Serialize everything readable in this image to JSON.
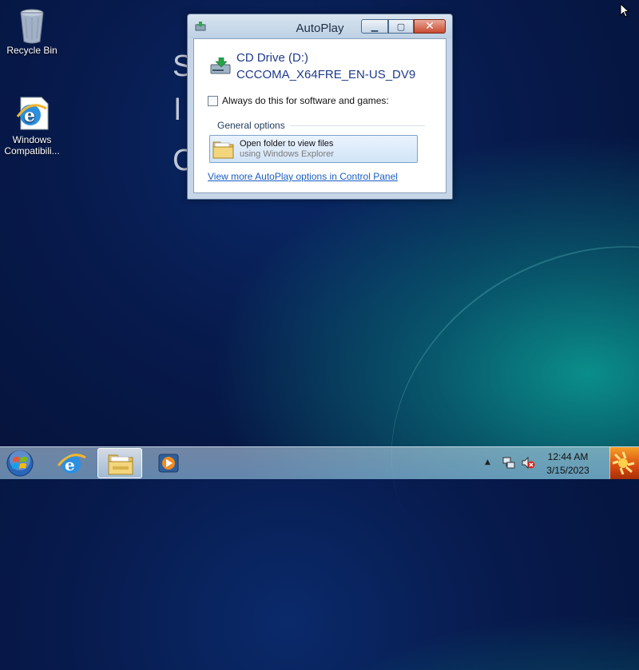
{
  "desktop": {
    "background_letters": [
      "S",
      "l",
      "C"
    ],
    "icons": [
      {
        "label": "Recycle Bin",
        "icon": "recycle-bin-icon"
      },
      {
        "label_line1": "Windows",
        "label_line2": "Compatibili...",
        "icon": "internet-explorer-icon"
      }
    ]
  },
  "dialog": {
    "title": "AutoPlay",
    "buttons": {
      "minimize": "minimize",
      "maximize": "maximize",
      "close": "close"
    },
    "drive_name": "CD Drive (D:)",
    "drive_label": "CCCOMA_X64FRE_EN-US_DV9",
    "always_do_label": "Always do this for software and games:",
    "always_checked": false,
    "section_title": "General options",
    "option": {
      "label": "Open folder to view files",
      "sublabel": "using Windows Explorer",
      "icon": "folder-icon"
    },
    "more_link": "View more AutoPlay options in Control Panel"
  },
  "taskbar": {
    "start_icon": "windows-start-orb-icon",
    "pinned": [
      {
        "name": "internet-explorer",
        "icon": "internet-explorer-icon",
        "active": false
      },
      {
        "name": "windows-explorer",
        "icon": "folder-icon",
        "active": true
      },
      {
        "name": "windows-media-player",
        "icon": "media-player-icon",
        "active": false
      }
    ],
    "tray": {
      "show_hidden": "▲",
      "network_icon": "network-icon",
      "volume_icon": "volume-muted-icon"
    },
    "clock": {
      "time": "12:44 AM",
      "date": "3/15/2023"
    }
  }
}
